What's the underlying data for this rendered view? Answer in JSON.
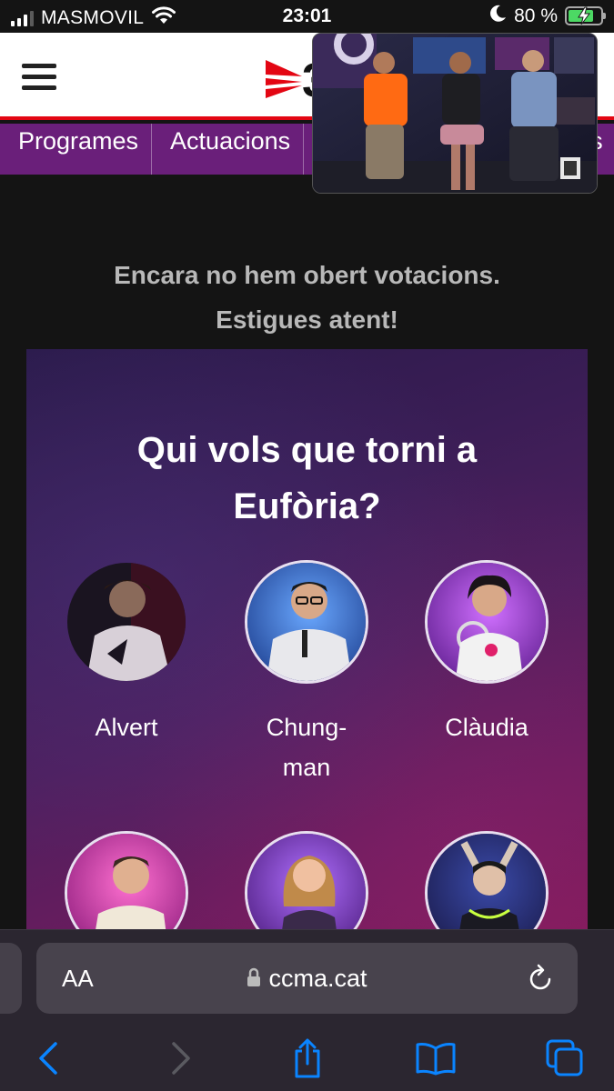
{
  "status_bar": {
    "carrier": "MASMOVIL",
    "time": "23:01",
    "battery_percent": "80 %",
    "battery_level": 0.8,
    "icons": [
      "signal-icon",
      "wifi-icon",
      "moon-icon",
      "battery-charging-icon"
    ]
  },
  "header": {
    "menu_icon": "hamburger-icon",
    "logo_icon": "3cat-logo"
  },
  "nav": {
    "items": [
      {
        "label": "Programes"
      },
      {
        "label": "Actuacions"
      },
      {
        "label": "es"
      }
    ]
  },
  "notice": {
    "line1": "Encara no hem obert votacions.",
    "line2": "Estigues atent!"
  },
  "voting": {
    "title_line1": "Qui vols que torni a",
    "title_line2": "Eufòria?",
    "contestants": [
      {
        "name": "Alvert"
      },
      {
        "name": "Chung-man",
        "name_line1": "Chung-",
        "name_line2": "man"
      },
      {
        "name": "Clàudia"
      },
      {
        "name": ""
      },
      {
        "name": ""
      },
      {
        "name": ""
      }
    ]
  },
  "browser": {
    "text_size_label": "AA",
    "url": "ccma.cat",
    "icons": [
      "lock-icon",
      "reload-icon",
      "back-icon",
      "forward-icon",
      "share-icon",
      "bookmarks-icon",
      "tabs-icon"
    ]
  },
  "colors": {
    "nav_purple": "#6a1f7a",
    "brand_red": "#e30613",
    "battery_green": "#4cd964",
    "ios_blue": "#0a84ff"
  }
}
